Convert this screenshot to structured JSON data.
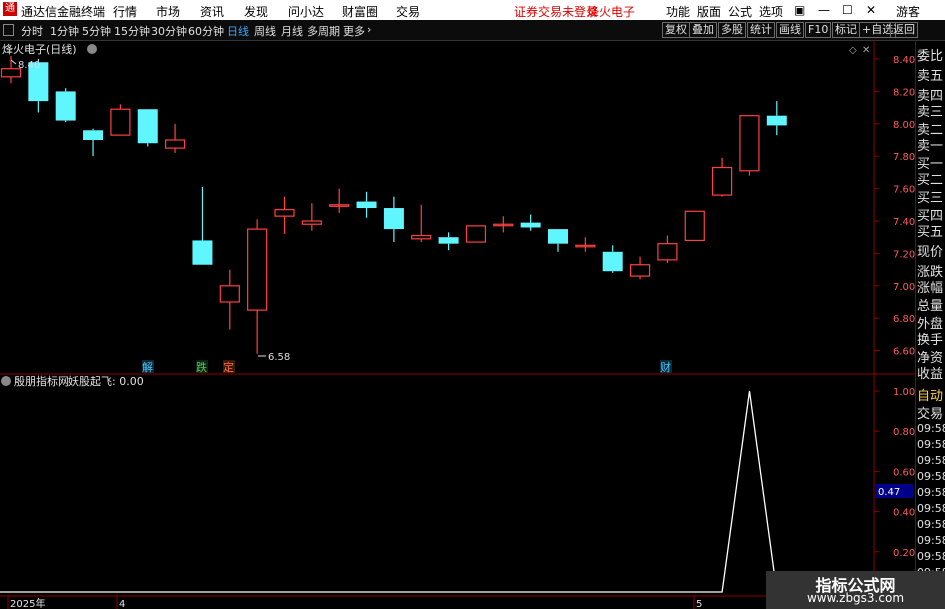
{
  "app": {
    "logo_text": "通",
    "title": "通达信金融终端",
    "menu": [
      "行情",
      "市场",
      "资讯",
      "发现",
      "问小达",
      "财富圈",
      "交易"
    ],
    "notice": "证券交易未登录",
    "stock_name": "烽火电子",
    "right_menu": [
      "功能",
      "版面",
      "公式",
      "选项"
    ],
    "win_controls": [
      "▣",
      "—",
      "☐",
      "✕"
    ],
    "user": "游客"
  },
  "toolbar": {
    "periods": [
      "分时",
      "1分钟",
      "5分钟",
      "15分钟",
      "30分钟",
      "60分钟",
      "日线",
      "周线",
      "月线",
      "多周期",
      "更多"
    ],
    "active_period": "日线",
    "right_buttons": [
      "复权",
      "叠加",
      "多股",
      "统计",
      "画线",
      "F10",
      "标记",
      "+自选",
      "返回"
    ]
  },
  "main_chart": {
    "label": "烽火电子(日线)",
    "high_label": "8.40",
    "low_label": "6.58",
    "yticks": [
      "8.40",
      "8.20",
      "8.00",
      "7.80",
      "7.60",
      "7.40",
      "7.20",
      "7.00",
      "6.80",
      "6.60"
    ],
    "event_markers": [
      {
        "text": "解",
        "color": "#4fc3f7"
      },
      {
        "text": "跌",
        "color": "#66bb6a"
      },
      {
        "text": "定",
        "color": "#ff7043"
      },
      {
        "text": "财",
        "color": "#4fc3f7"
      }
    ]
  },
  "indicator": {
    "name": "殷朋指标网",
    "series_label": "妖股起飞: 0.00",
    "yticks": [
      "1.00",
      "0.80",
      "0.60",
      "0.40",
      "0.20"
    ],
    "cursor_value": "0.47"
  },
  "xaxis": {
    "labels": [
      "2025年",
      "4",
      "5"
    ]
  },
  "side_panel": {
    "items": [
      "委比",
      "卖五",
      "卖四",
      "卖三",
      "卖二",
      "卖一",
      "买一",
      "买二",
      "买三",
      "买四",
      "买五",
      "现价",
      "涨跌",
      "涨幅",
      "总量",
      "外盘",
      "换手",
      "净资",
      "收益",
      "自动",
      "交易",
      "09:58",
      "09:58",
      "09:58",
      "09:58",
      "09:58",
      "09:58",
      "09:58",
      "09:58",
      "09:58",
      "09:58"
    ]
  },
  "watermark": {
    "line1": "指标公式网",
    "line2": "www.zbgs3.com"
  },
  "chart_data": [
    {
      "type": "candlestick",
      "title": "烽火电子(日线)",
      "ylim": [
        6.5,
        8.5
      ],
      "up_color": "#ff4040",
      "down_color": "#5ff6ff",
      "candles": [
        {
          "o": 8.29,
          "c": 8.34,
          "h": 8.42,
          "l": 8.25
        },
        {
          "o": 8.38,
          "c": 8.14,
          "h": 8.4,
          "l": 8.07
        },
        {
          "o": 8.2,
          "c": 8.02,
          "h": 8.22,
          "l": 8.01
        },
        {
          "o": 7.96,
          "c": 7.9,
          "h": 7.97,
          "l": 7.8
        },
        {
          "o": 7.93,
          "c": 8.09,
          "h": 8.12,
          "l": 7.93
        },
        {
          "o": 8.09,
          "c": 7.88,
          "h": 8.09,
          "l": 7.86
        },
        {
          "o": 7.85,
          "c": 7.9,
          "h": 8.0,
          "l": 7.82
        },
        {
          "o": 7.28,
          "c": 7.13,
          "h": 7.61,
          "l": 7.13
        },
        {
          "o": 6.9,
          "c": 7.0,
          "h": 7.1,
          "l": 6.73
        },
        {
          "o": 6.85,
          "c": 7.35,
          "h": 7.41,
          "l": 6.58
        },
        {
          "o": 7.43,
          "c": 7.47,
          "h": 7.55,
          "l": 7.32
        },
        {
          "o": 7.38,
          "c": 7.4,
          "h": 7.51,
          "l": 7.34
        },
        {
          "o": 7.5,
          "c": 7.5,
          "h": 7.6,
          "l": 7.45
        },
        {
          "o": 7.52,
          "c": 7.48,
          "h": 7.58,
          "l": 7.42
        },
        {
          "o": 7.48,
          "c": 7.35,
          "h": 7.55,
          "l": 7.27
        },
        {
          "o": 7.29,
          "c": 7.31,
          "h": 7.5,
          "l": 7.27
        },
        {
          "o": 7.3,
          "c": 7.26,
          "h": 7.33,
          "l": 7.22
        },
        {
          "o": 7.27,
          "c": 7.37,
          "h": 7.37,
          "l": 7.27
        },
        {
          "o": 7.38,
          "c": 7.38,
          "h": 7.43,
          "l": 7.33
        },
        {
          "o": 7.39,
          "c": 7.36,
          "h": 7.44,
          "l": 7.34
        },
        {
          "o": 7.35,
          "c": 7.26,
          "h": 7.35,
          "l": 7.21
        },
        {
          "o": 7.25,
          "c": 7.25,
          "h": 7.3,
          "l": 7.21
        },
        {
          "o": 7.21,
          "c": 7.09,
          "h": 7.25,
          "l": 7.08
        },
        {
          "o": 7.06,
          "c": 7.13,
          "h": 7.18,
          "l": 7.04
        },
        {
          "o": 7.16,
          "c": 7.26,
          "h": 7.31,
          "l": 7.14
        },
        {
          "o": 7.28,
          "c": 7.46,
          "h": 7.46,
          "l": 7.28
        },
        {
          "o": 7.56,
          "c": 7.73,
          "h": 7.79,
          "l": 7.55
        },
        {
          "o": 7.71,
          "c": 8.05,
          "h": 8.05,
          "l": 7.68
        },
        {
          "o": 8.05,
          "c": 7.99,
          "h": 8.14,
          "l": 7.93
        }
      ]
    },
    {
      "type": "line",
      "title": "妖股起飞",
      "ylim": [
        0,
        1.05
      ],
      "values": [
        0,
        0,
        0,
        0,
        0,
        0,
        0,
        0,
        0,
        0,
        0,
        0,
        0,
        0,
        0,
        0,
        0,
        0,
        0,
        0,
        0,
        0,
        0,
        0,
        0,
        0,
        0,
        1.0,
        0,
        0
      ]
    }
  ]
}
